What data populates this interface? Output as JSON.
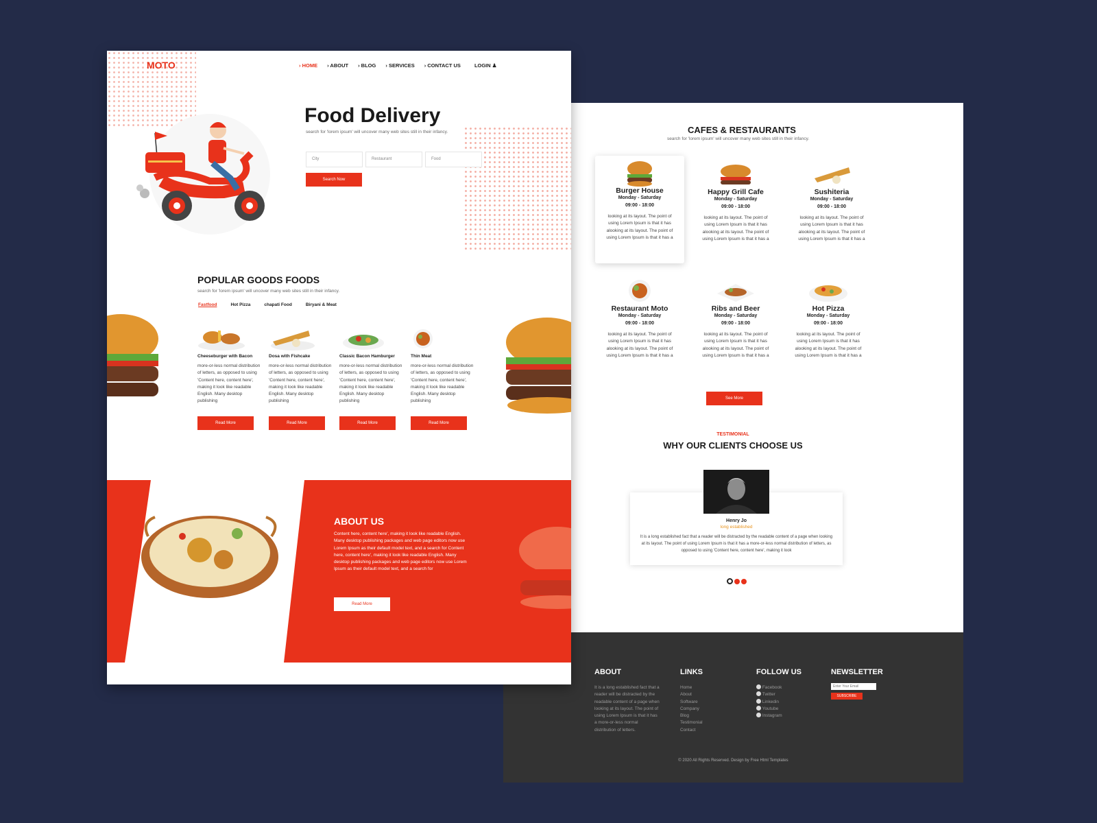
{
  "brand": {
    "logo": "MOTO",
    "accent": "#e8321b",
    "background": "#232b48",
    "footer_bg": "#333333"
  },
  "nav": {
    "items": [
      {
        "label": "HOME",
        "active": true
      },
      {
        "label": "ABOUT"
      },
      {
        "label": "BLOG"
      },
      {
        "label": "SERVICES"
      },
      {
        "label": "CONTACT US"
      }
    ],
    "login": "LOGIN",
    "chevron": "›"
  },
  "hero": {
    "title": "Food Delivery",
    "subtitle": "search for 'lorem ipsum' will uncover many web sites still in their infancy.",
    "city_placeholder": "City",
    "restaurant_placeholder": "Restaurant",
    "food_placeholder": "Food",
    "search_button": "Search Now"
  },
  "popular": {
    "title": "POPULAR GOODS FOODS",
    "subtitle": "search for 'lorem ipsum' will uncover many web sites still in their infancy.",
    "tabs": [
      "Fastfood",
      "Hot Pizza",
      "chapati Food",
      "Biryani & Meat"
    ],
    "items": [
      {
        "name": "Cheeseburger with Bacon",
        "text": "more-or-less normal distribution of letters, as opposed to using 'Content here, content here', making it look like readable English. Many desktop publishing",
        "button": "Read More"
      },
      {
        "name": "Dosa with Fishcake",
        "text": "more-or-less normal distribution of letters, as opposed to using 'Content here, content here', making it look like readable English. Many desktop publishing",
        "button": "Read More"
      },
      {
        "name": "Classic Bacon Hamburger",
        "text": "more-or-less normal distribution of letters, as opposed to using 'Content here, content here', making it look like readable English. Many desktop publishing",
        "button": "Read More"
      },
      {
        "name": "Thin Meat",
        "text": "more-or-less normal distribution of letters, as opposed to using 'Content here, content here', making it look like readable English. Many desktop publishing",
        "button": "Read More"
      }
    ]
  },
  "about": {
    "title": "ABOUT US",
    "text": "Content here, content here', making it look like readable English. Many desktop publishing packages and web page editors now use Lorem Ipsum as their default model text, and a search for Content here, content here', making it look like readable English. Many desktop publishing packages and web page editors now use Lorem Ipsum as their default model text, and a search for",
    "button": "Read More"
  },
  "cafes": {
    "title": "CAFES & RESTAURANTS",
    "subtitle": "search for 'lorem ipsum' will uncover many web sites still in their infancy.",
    "items": [
      {
        "name": "Burger House",
        "days": "Monday - Saturday",
        "hours": "09:00 - 18:00",
        "text": "looking at its layout. The point of using Lorem Ipsum is that it has alooking at its layout. The point of using Lorem Ipsum is that it has a",
        "highlight": true
      },
      {
        "name": "Happy Grill Cafe",
        "days": "Monday - Saturday",
        "hours": "09:00 - 18:00",
        "text": "looking at its layout. The point of using Lorem Ipsum is that it has alooking at its layout. The point of using Lorem Ipsum is that it has a"
      },
      {
        "name": "Sushiteria",
        "days": "Monday - Saturday",
        "hours": "09:00 - 18:00",
        "text": "looking at its layout. The point of using Lorem Ipsum is that it has alooking at its layout. The point of using Lorem Ipsum is that it has a"
      },
      {
        "name": "Restaurant Moto",
        "days": "Monday - Saturday",
        "hours": "09:00 - 18:00",
        "text": "looking at its layout. The point of using Lorem Ipsum is that it has alooking at its layout. The point of using Lorem Ipsum is that it has a"
      },
      {
        "name": "Ribs and Beer",
        "days": "Monday - Saturday",
        "hours": "09:00 - 18:00",
        "text": "looking at its layout. The point of using Lorem Ipsum is that it has alooking at its layout. The point of using Lorem Ipsum is that it has a"
      },
      {
        "name": "Hot Pizza",
        "days": "Monday - Saturday",
        "hours": "09:00 - 18:00",
        "text": "looking at its layout. The point of using Lorem Ipsum is that it has alooking at its layout. The point of using Lorem Ipsum is that it has a"
      }
    ],
    "see_more": "See More"
  },
  "testimonial": {
    "kicker": "TESTIMONIAL",
    "title": "WHY OUR CLIENTS CHOOSE US",
    "name": "Henry Jo",
    "role": "long established",
    "text": "It is a long established fact that a reader will be distracted by the readable content of a page when looking at its layout. The point of using Lorem Ipsum is that it has a more-or-less normal distribution of letters, as opposed to using 'Content here, content here', making it look"
  },
  "footer": {
    "about_title": "ABOUT",
    "about_text": "It is a long established fact that a reader will be distracted by the readable content of a page when looking at its layout. The point of using Lorem Ipsum is that it has a more-or-less normal distribution of letters.",
    "links_title": "LINKS",
    "links": [
      "Home",
      "About",
      "Software",
      "Company",
      "Blog",
      "Testimonial",
      "Contact"
    ],
    "follow_title": "FOLLOW US",
    "social": [
      "Facebook",
      "Twitter",
      "Linkedin",
      "Youtube",
      "Instagram"
    ],
    "newsletter_title": "NEWSLETTER",
    "email_placeholder": "Enter Your Email",
    "subscribe": "SUBSCRIBE",
    "copyright": "© 2020 All Rights Reserved. Design by Free Html Templates"
  }
}
